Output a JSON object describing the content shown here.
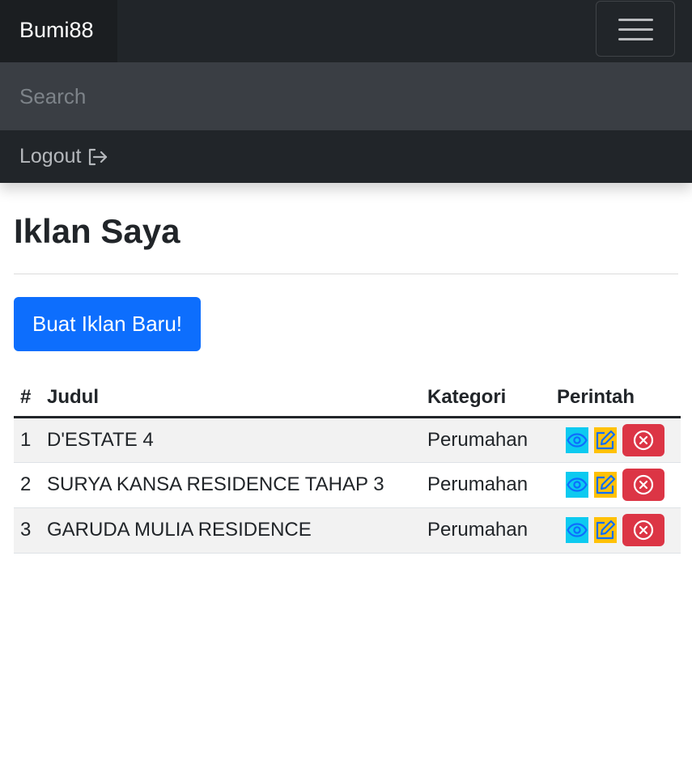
{
  "navbar": {
    "brand": "Bumi88",
    "search_placeholder": "Search",
    "logout_label": "Logout"
  },
  "main": {
    "title": "Iklan Saya",
    "create_button": "Buat Iklan Baru!"
  },
  "table": {
    "headers": {
      "num": "#",
      "title": "Judul",
      "category": "Kategori",
      "actions": "Perintah"
    },
    "rows": [
      {
        "num": "1",
        "title": "D'ESTATE 4",
        "category": "Perumahan"
      },
      {
        "num": "2",
        "title": "SURYA KANSA RESIDENCE TAHAP 3",
        "category": "Perumahan"
      },
      {
        "num": "3",
        "title": "GARUDA MULIA RESIDENCE",
        "category": "Perumahan"
      }
    ]
  },
  "icons": {
    "menu": "hamburger-icon",
    "logout": "box-arrow-right-icon",
    "view": "eye-icon",
    "edit": "pencil-square-icon",
    "delete": "x-circle-icon"
  },
  "colors": {
    "navbar": "#212529",
    "primary": "#0d6efd",
    "info": "#0dcaf0",
    "warning": "#ffc107",
    "danger": "#dc3545"
  }
}
